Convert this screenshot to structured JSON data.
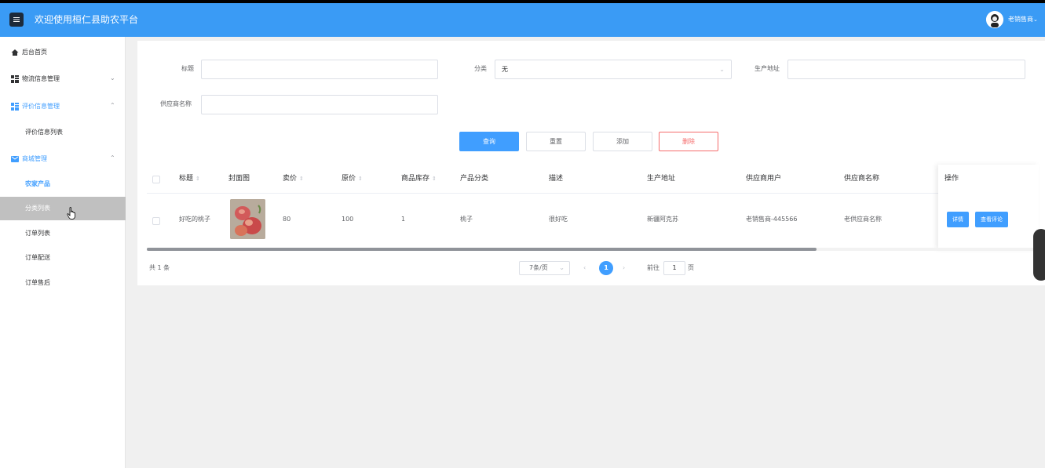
{
  "header": {
    "app_title": "欢迎使用桓仁县助农平台",
    "user_name": "老销售商",
    "caret": "⌄",
    "menu_icon": "menu-icon",
    "colors": {
      "header_bg": "#3a9bf5",
      "accent": "#409eff",
      "danger": "#f56c6c"
    }
  },
  "sidebar": {
    "items": [
      {
        "label": "后台首页",
        "icon": "home-icon"
      },
      {
        "label": "物流信息管理",
        "icon": "grid-icon",
        "arrow": "⌄"
      },
      {
        "label": "评价信息管理",
        "icon": "grid-icon",
        "arrow": "⌃"
      },
      {
        "label": "评价信息列表"
      },
      {
        "label": "商城管理",
        "icon": "mail-icon",
        "arrow": "⌃"
      },
      {
        "label": "农家产品"
      },
      {
        "label": "分类列表"
      },
      {
        "label": "订单列表"
      },
      {
        "label": "订单配送"
      },
      {
        "label": "订单售后"
      }
    ]
  },
  "filters": {
    "title_label": "标题",
    "title_value": "",
    "category_label": "分类",
    "category_value": "无",
    "address_label": "生产地址",
    "address_value": "",
    "supplier_label": "供应商名称",
    "supplier_value": ""
  },
  "actions": {
    "query": "查询",
    "reset": "重置",
    "add": "添加",
    "delete": "删除"
  },
  "table": {
    "headers": [
      "标题",
      "封面图",
      "卖价",
      "原价",
      "商品库存",
      "产品分类",
      "描述",
      "生产地址",
      "供应商用户",
      "供应商名称",
      "操作"
    ],
    "rows": [
      {
        "title": "好吃的桃子",
        "price": "80",
        "original_price": "100",
        "stock": "1",
        "category": "桃子",
        "description": "很好吃",
        "address": "新疆阿克苏",
        "supplier_user": "老销售商-445566",
        "supplier_name": "老供应商名称",
        "detail_btn": "详情",
        "review_btn": "查看评论"
      }
    ]
  },
  "pagination": {
    "total": "共 1 条",
    "page_size": "7条/页",
    "current_page": "1",
    "goto_label": "前往",
    "goto_value": "1",
    "page_unit": "页",
    "prev": "‹",
    "next": "›"
  }
}
